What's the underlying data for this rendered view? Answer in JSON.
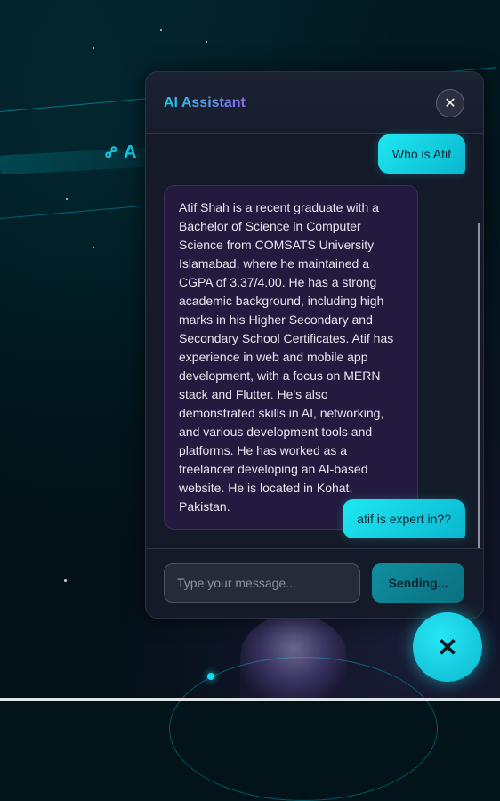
{
  "background": {
    "link_text": "A"
  },
  "chat": {
    "title": "AI Assistant",
    "close_label": "✕",
    "messages": [
      {
        "role": "user",
        "text": "Who is Atif"
      },
      {
        "role": "assistant",
        "text": "Atif Shah is a recent graduate with a Bachelor of Science in Computer Science from COMSATS University Islamabad, where he maintained a CGPA of 3.37/4.00. He has a strong academic background, including high marks in his Higher Secondary and Secondary School Certificates. Atif has experience in web and mobile app development, with a focus on MERN stack and Flutter. He's also demonstrated skills in AI, networking, and various development tools and platforms. He has worked as a freelancer developing an AI-based website. He is located in Kohat, Pakistan."
      },
      {
        "role": "user",
        "text": "atif is expert in??"
      }
    ],
    "input_placeholder": "Type your message...",
    "send_label": "Sending..."
  },
  "fab": {
    "label": "✕"
  },
  "colors": {
    "accent": "#1ee8f2",
    "ai_bubble": "#24193e",
    "panel": "#141a28"
  }
}
